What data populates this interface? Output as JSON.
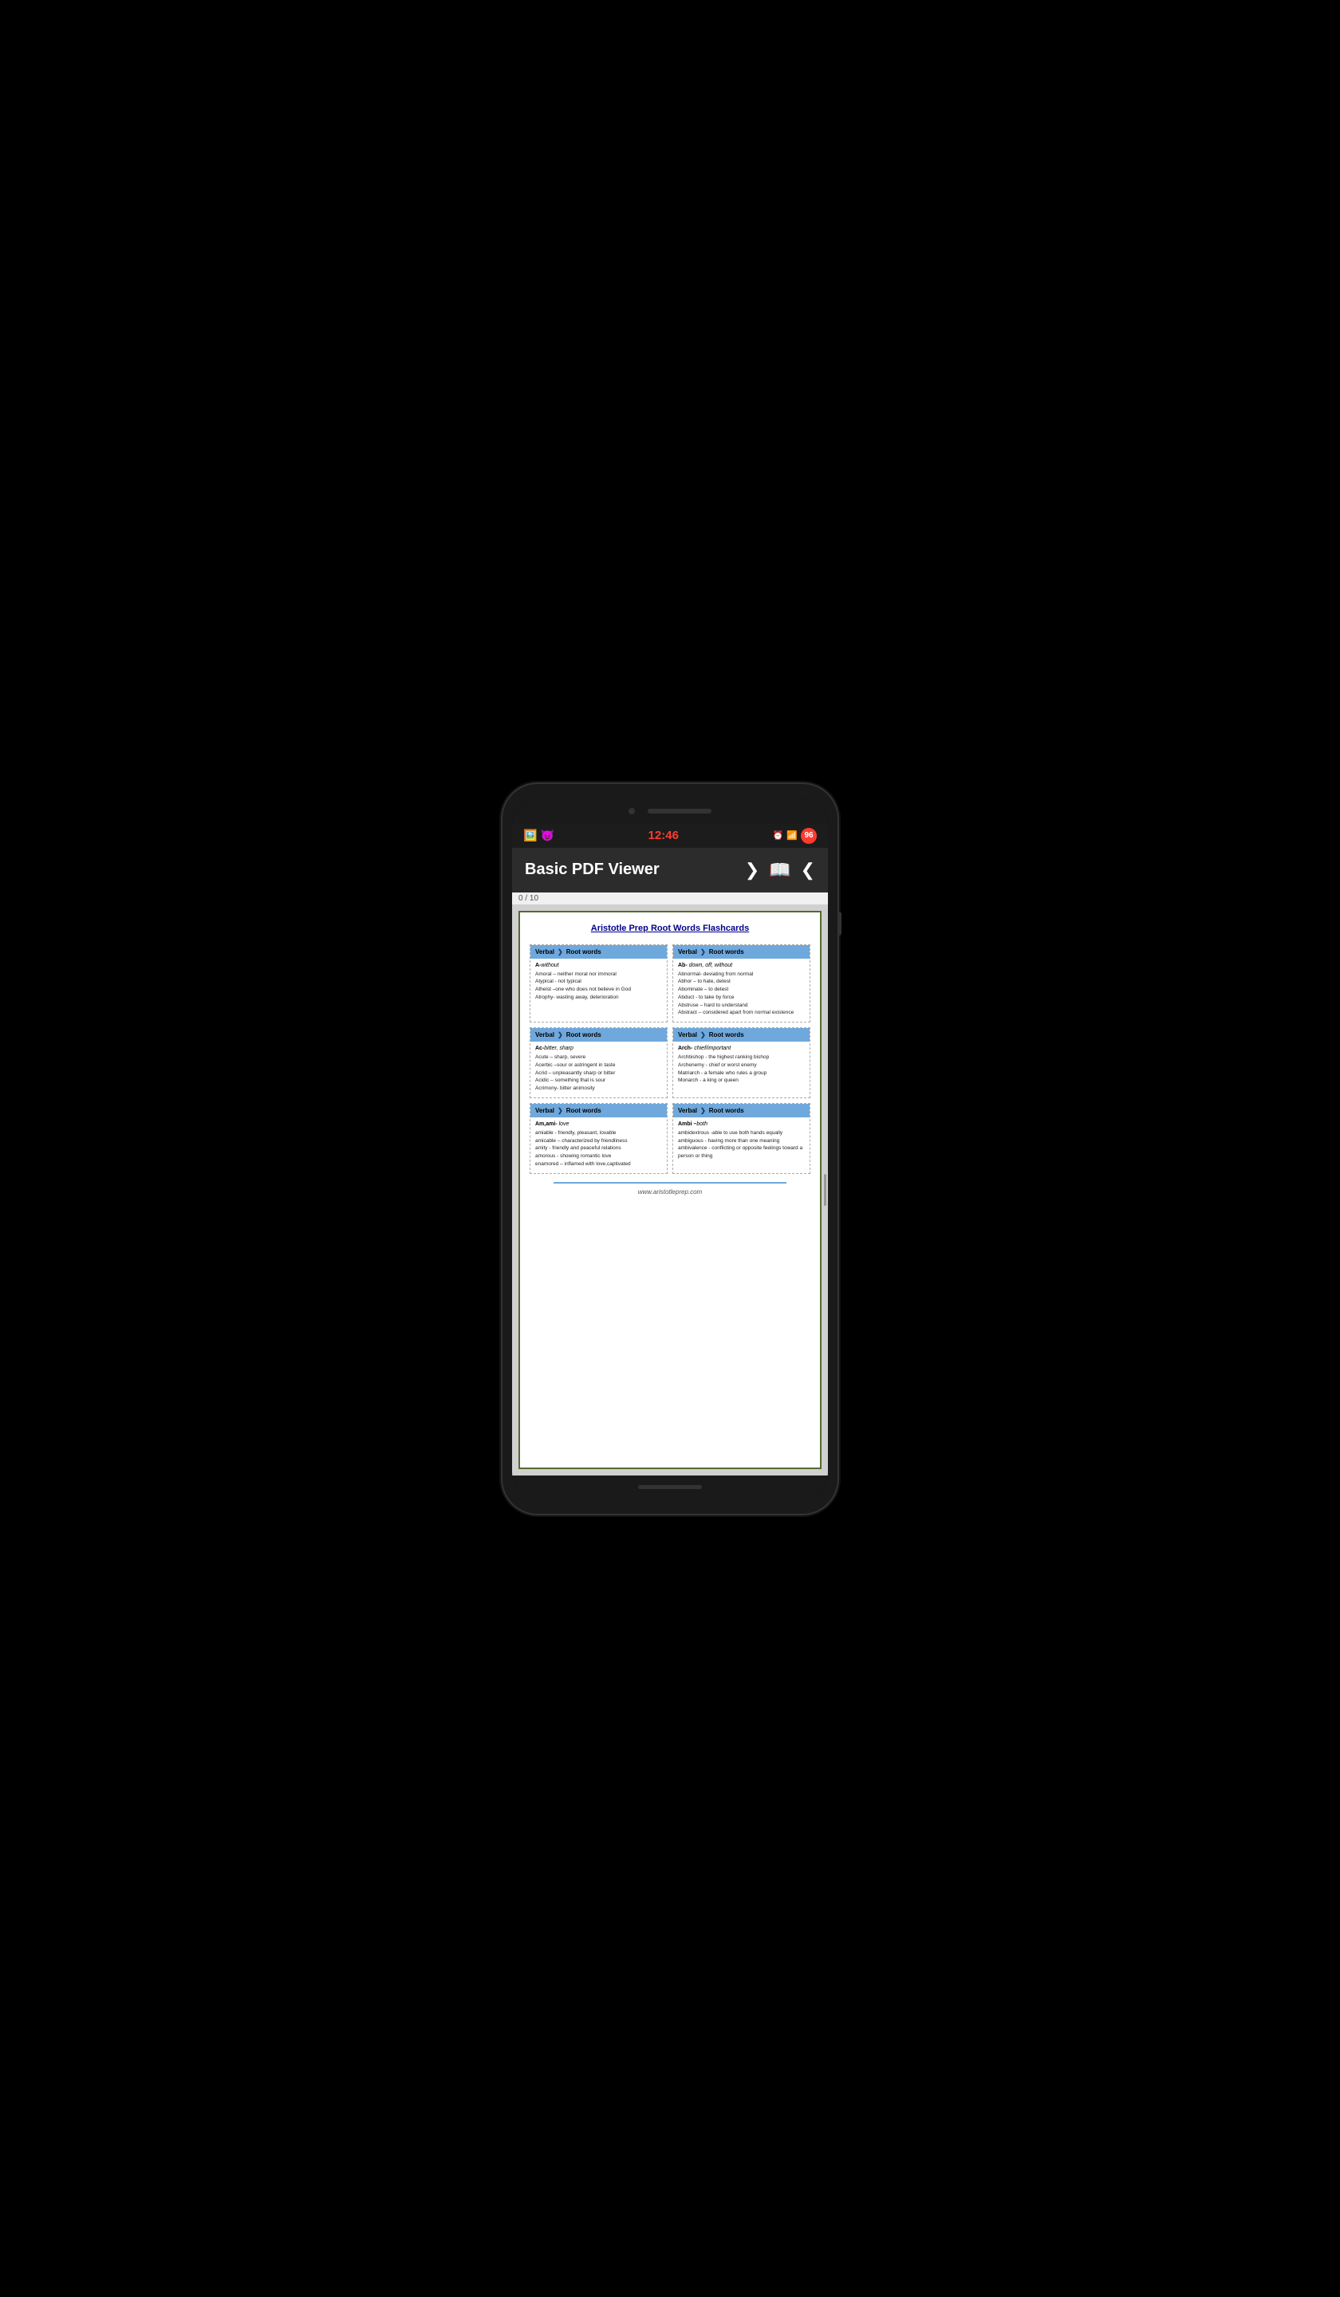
{
  "phone": {
    "status_bar": {
      "time": "12:46",
      "battery": "96",
      "left_icons": [
        "🖼️",
        "😈"
      ]
    },
    "header": {
      "title": "Basic PDF Viewer",
      "nav_forward": "❯",
      "nav_book": "📖",
      "nav_back": "❮"
    },
    "page_indicator": "0 / 10"
  },
  "pdf": {
    "title": "Aristotle Prep  Root Words Flashcards",
    "footer_url": "www.aristotleprep.com",
    "cards": [
      {
        "id": "card-a",
        "header_verbal": "Verbal",
        "header_root": "Root words",
        "root_label_bold": "A-",
        "root_label_italic": "without",
        "entries": [
          "Amoral – neither moral nor immoral",
          "Atypical -  not typical",
          "Atheist –one who does not believe in God",
          "Atrophy- wasting away, deterioration"
        ]
      },
      {
        "id": "card-ab",
        "header_verbal": "Verbal",
        "header_root": "Root words",
        "root_label_bold": "Ab-",
        "root_label_italic": " down, off, without",
        "entries": [
          "Abnormal- deviating from normal",
          "Abhor – to hate, detest",
          "Abominate – to detest",
          "Abduct - to take by force",
          "Abstruse – hard to understand",
          "Abstract – considered apart from normal existence"
        ]
      },
      {
        "id": "card-ac",
        "header_verbal": "Verbal",
        "header_root": "Root words",
        "root_label_bold": "Ac-",
        "root_label_italic": "bitter, sharp",
        "entries": [
          "Acute – sharp, severe",
          "Acerbic –sour or astringent in taste",
          "Acrid – unpleasantly sharp or bitter",
          "Acidic – something that is sour",
          "Acrimony- bitter animosity"
        ]
      },
      {
        "id": "card-arch",
        "header_verbal": "Verbal",
        "header_root": "Root words",
        "root_label_bold": "Arch-",
        "root_label_italic": " chief/important",
        "entries": [
          "Archbishop - the highest ranking bishop",
          "Archenemy - chief or worst enemy",
          "Matriarch - a female who rules a group",
          "Monarch - a king or queen"
        ]
      },
      {
        "id": "card-am",
        "header_verbal": "Verbal",
        "header_root": "Root words",
        "root_label_bold": "Am,ami-",
        "root_label_italic": " love",
        "entries": [
          "amiable - friendly, pleasant, lovable",
          "amicable – characterized by friendliness",
          "amity - friendly and peaceful relations",
          "amorous - showing romantic love",
          "enamored – inflamed with love,captivated"
        ]
      },
      {
        "id": "card-ambi",
        "header_verbal": "Verbal",
        "header_root": "Root words",
        "root_label_bold": "Ambi –",
        "root_label_italic": "both",
        "entries": [
          "ambidextrous -able to use both hands equally",
          "ambiguous -  having more than one meaning",
          "ambivalence - conflicting or opposite feelings toward a person or thing"
        ]
      }
    ]
  }
}
